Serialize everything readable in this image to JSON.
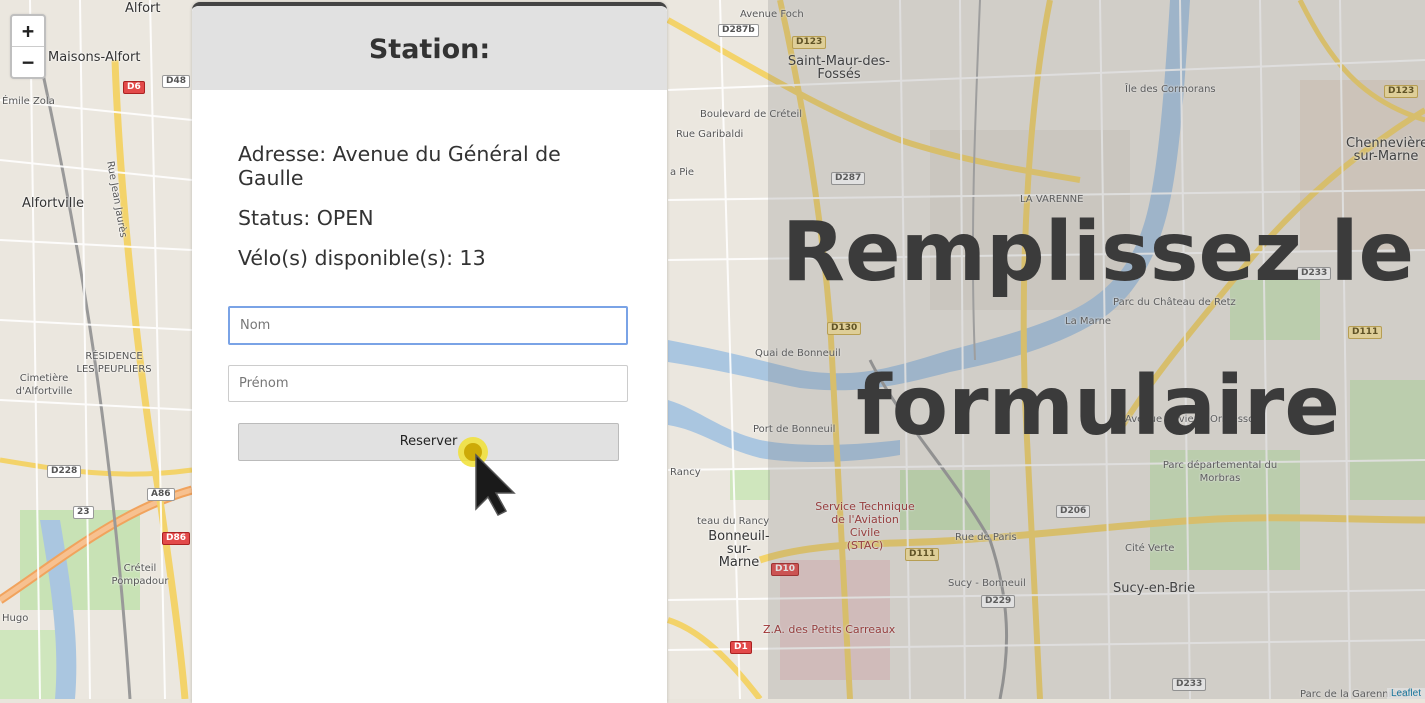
{
  "map": {
    "zoom_in": "+",
    "zoom_out": "−",
    "attribution": "Leaflet",
    "labels": [
      {
        "text": "Maisons-Alfort",
        "cls": "town"
      },
      {
        "text": "Alfortville",
        "cls": "town"
      },
      {
        "text": "Saint-Maur-des-\nFossés",
        "cls": "town"
      },
      {
        "text": "Chennevière\nsur-Marne",
        "cls": "town"
      },
      {
        "text": "Sucy-en-Brie",
        "cls": "town"
      },
      {
        "text": "Bonneuil-sur-\nMarne",
        "cls": "town"
      },
      {
        "text": "RÉSIDENCE\nLES PEUPLIERS",
        "cls": "small"
      },
      {
        "text": "Cimetière\nd'Alfortville",
        "cls": "small"
      },
      {
        "text": "Créteil\nPompadour",
        "cls": "small"
      },
      {
        "text": "Quai de Bonneuil",
        "cls": "street"
      },
      {
        "text": "Port de Bonneuil",
        "cls": "small"
      },
      {
        "text": "teau du Rancy",
        "cls": "small"
      },
      {
        "text": "Service Technique\nde l'Aviation Civile\n(STAC)",
        "cls": "red"
      },
      {
        "text": "Z.A. des Petits Carreaux",
        "cls": "red"
      },
      {
        "text": "Parc départemental du\nMorbras",
        "cls": "small"
      },
      {
        "text": "Cité Verte",
        "cls": "small"
      },
      {
        "text": "Sucy - Bonneuil",
        "cls": "small"
      },
      {
        "text": "Parc du Château de Retz",
        "cls": "small"
      },
      {
        "text": "Avenue Olivier d'Ormesson",
        "cls": "street"
      },
      {
        "text": "Rue de Paris",
        "cls": "street"
      },
      {
        "text": "Boulevard de Créteil",
        "cls": "street"
      },
      {
        "text": "Île des Cormorans",
        "cls": "small"
      },
      {
        "text": "La Marne",
        "cls": "street"
      },
      {
        "text": "Rue Garibaldi",
        "cls": "street"
      },
      {
        "text": "Rue Jean Jaurès",
        "cls": "street"
      },
      {
        "text": "Émile Zola",
        "cls": "street"
      },
      {
        "text": "Alfort",
        "cls": "town"
      },
      {
        "text": "Parc de la Garennière",
        "cls": "street"
      },
      {
        "text": "LA VARENNE",
        "cls": "small"
      },
      {
        "text": "Avenue Foch",
        "cls": "street"
      },
      {
        "text": "Rancy",
        "cls": "small"
      },
      {
        "text": "a Pie",
        "cls": "small"
      },
      {
        "text": "Hugo",
        "cls": "street"
      }
    ],
    "shields": [
      {
        "text": "D287b",
        "kind": "dd"
      },
      {
        "text": "D123",
        "kind": "d"
      },
      {
        "text": "D6",
        "kind": "red"
      },
      {
        "text": "D48",
        "kind": "dd"
      },
      {
        "text": "D287",
        "kind": "dd"
      },
      {
        "text": "D130",
        "kind": "d"
      },
      {
        "text": "D228",
        "kind": "dd"
      },
      {
        "text": "A86",
        "kind": "dd"
      },
      {
        "text": "23",
        "kind": "dd"
      },
      {
        "text": "D86",
        "kind": "red"
      },
      {
        "text": "D10",
        "kind": "red"
      },
      {
        "text": "D1",
        "kind": "red"
      },
      {
        "text": "D111",
        "kind": "d"
      },
      {
        "text": "D206",
        "kind": "dd"
      },
      {
        "text": "D229",
        "kind": "dd"
      },
      {
        "text": "D233",
        "kind": "dd"
      },
      {
        "text": "D111",
        "kind": "d"
      },
      {
        "text": "D123",
        "kind": "d"
      },
      {
        "text": "D233",
        "kind": "dd"
      }
    ]
  },
  "overlay": {
    "heading": "Remplissez le formulaire"
  },
  "panel": {
    "title": "Station:",
    "address": "Adresse: Avenue du Général de Gaulle",
    "status": "Status: OPEN",
    "bikes": "Vélo(s) disponible(s): 13",
    "nom_placeholder": "Nom",
    "prenom_placeholder": "Prénom",
    "reserve_label": "Reserver"
  }
}
